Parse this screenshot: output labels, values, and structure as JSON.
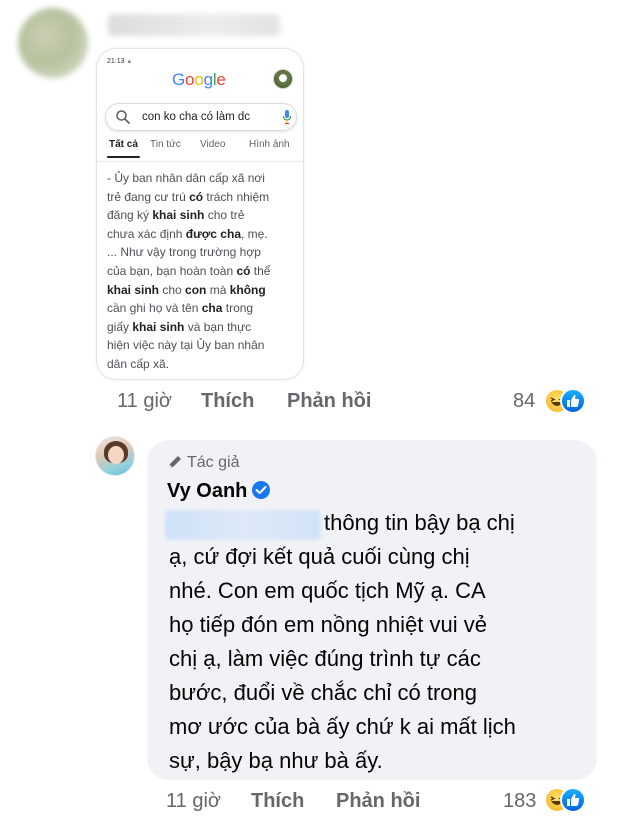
{
  "comment1": {
    "phone_screenshot": {
      "status_time": "21:13",
      "google_logo": "Google",
      "search_query": "con ko cha có làm dc",
      "tabs": [
        {
          "label": "Tất cả",
          "active": true
        },
        {
          "label": "Tin tức",
          "active": false
        },
        {
          "label": "Video",
          "active": false
        },
        {
          "label": "Hình ảnh",
          "active": false
        }
      ],
      "snippet_lines": [
        "- Ủy ban nhân dân cấp xã nơi",
        "trẻ đang cư trú <b>có</b> trách nhiệm",
        "đăng ký <b>khai sinh</b> cho trẻ",
        "chưa xác định <b>được cha</b>, mẹ.",
        "... Như vậy trong trường hợp",
        "của bạn, bạn hoàn toàn <b>có</b> thể",
        "<b>khai sinh</b> cho <b>con</b> mà <b>không</b>",
        "cần ghi họ và tên <b>cha</b> trong",
        "giấy <b>khai sinh</b> và bạn thực",
        "hiện việc này tại Ủy ban nhân",
        "dân cấp xã."
      ]
    },
    "time": "11 giờ",
    "like_label": "Thích",
    "reply_label": "Phản hồi",
    "reaction_count": "84"
  },
  "reply": {
    "author_badge": "Tác giả",
    "author_name": "Vy Oanh",
    "text_lines": [
      "thông tin bậy bạ chị",
      "ạ, cứ đợi kết quả cuối cùng chị",
      "nhé. Con em quốc tịch Mỹ ạ. CA",
      "họ tiếp đón em nồng nhiệt vui vẻ",
      "chị ạ, làm việc đúng trình tự các",
      "bước, đuổi về chắc chỉ có trong",
      "mơ ước của bà ấy chứ k ai mất lịch",
      "sự, bậy bạ như bà ấy."
    ],
    "time": "11 giờ",
    "like_label": "Thích",
    "reply_label": "Phản hồi",
    "reaction_count": "183"
  },
  "icons": [
    "search-icon",
    "mic-icon",
    "pen-icon",
    "verified-icon",
    "haha-reaction-icon",
    "like-reaction-icon"
  ],
  "colors": {
    "accent": "#1877f2",
    "meta_text": "#65676b",
    "bubble": "#f0f2f5"
  }
}
